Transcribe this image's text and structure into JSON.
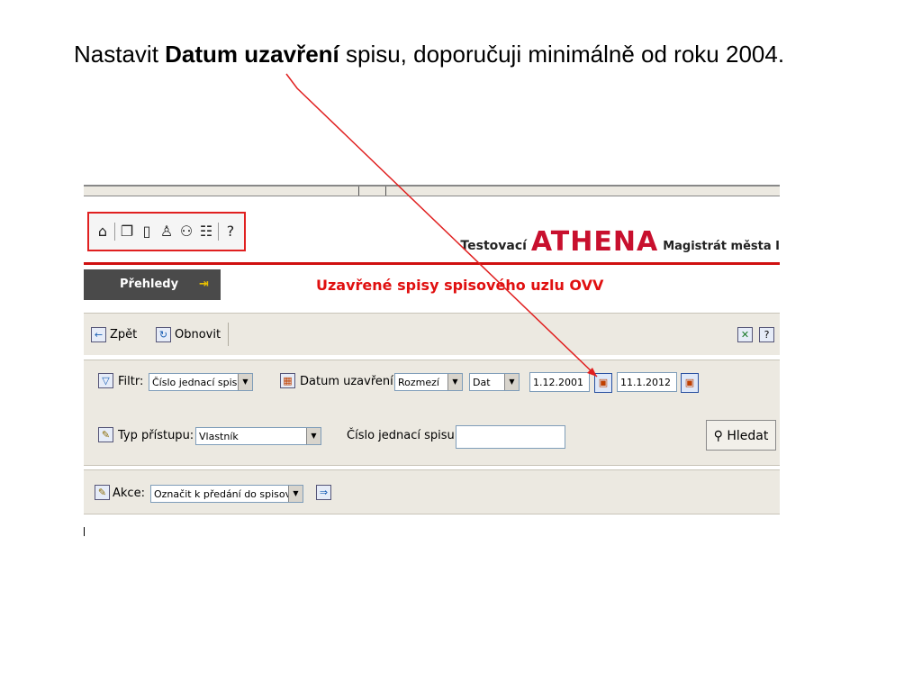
{
  "caption": {
    "part1": "Nastavit ",
    "bold": "Datum  uzavření",
    "part2": " spisu, doporučuji minimálně od roku 2004."
  },
  "app": {
    "toolbar_icons": [
      "home-icon",
      "documents-icon",
      "document-icon",
      "user-search-icon",
      "users-icon",
      "list-icon",
      "help-icon"
    ],
    "help_label": "?",
    "brand": {
      "prefix": "Testovací",
      "name": "ATHENA",
      "suffix": "Magistrát města I"
    },
    "nav": {
      "overview_label": "Přehledy",
      "page_title": "Uzavřené spisy spisového uzlu OVV"
    },
    "buttons": {
      "back": "Zpět",
      "refresh": "Obnovit",
      "help": "?"
    },
    "filter": {
      "filter_label": "Filtr:",
      "filter_value": "Číslo jednací spisu",
      "date_label": "Datum uzavření:",
      "range_value": "Rozmezí",
      "type_value": "Dat",
      "date_from": "1.12.2001",
      "date_to": "11.1.2012",
      "access_label": "Typ přístupu:",
      "access_value": "Vlastník",
      "ref_label": "Číslo jednací spisu:",
      "ref_value": "",
      "search_label": "Hledat"
    },
    "actions": {
      "label": "Akce:",
      "value": "Označit k předání do spisovny"
    }
  },
  "colors": {
    "accent_red": "#e01010",
    "brand_red": "#c8102e",
    "panel_bg": "#ece9e1",
    "nav_dark": "#4a4a4a"
  }
}
